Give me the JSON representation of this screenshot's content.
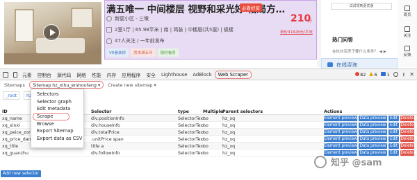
{
  "listing": {
    "title": "满五唯一 中间楼层 视野和采光好 格局方…",
    "badge": "必看好房",
    "community": "新壁小区 - 三墩",
    "layout": "2室1厅 | 65.98平米 | 南 | 简装 | 中楼层(共5层) | 板楼",
    "followers": "47人关注 / 一年前发布",
    "price": "210",
    "price_unit": "万",
    "unit_price": "单价31828元/平米",
    "tags": [
      "VR看装修",
      "房本满五年",
      "随时看房"
    ]
  },
  "right_panel": {
    "consult_label": "试试领到更优惠",
    "hot_questions_title": "热门问答",
    "hot_question_text": "在杭州买房子要什么条件？ ◀ ▶",
    "online_label": "在线咨询"
  },
  "sidebar_right": {
    "items": [
      "首页",
      "关注",
      "反馈"
    ]
  },
  "devtools": {
    "tabs": [
      "元素",
      "控制台",
      "源代码",
      "网络",
      "性能",
      "内存",
      "应用程序",
      "安全",
      "Lighthouse",
      "AdBlock",
      "Web Scraper"
    ],
    "active_tab": "Web Scraper",
    "error_count": "82",
    "warning_count": "6",
    "message_count": "1"
  },
  "ws_nav": {
    "sitemaps": "Sitemaps",
    "current_sitemap": "Sitemap hz_xihu_ershoufang ▾",
    "create_sitemap": "Create new sitemap ▾"
  },
  "breadcrumb": [
    "_root",
    "hz_xq"
  ],
  "dropdown": {
    "items": [
      "Selectors",
      "Selector graph",
      "Edit metadata",
      "Scrape",
      "Browse",
      "Export Sitemap",
      "Export data as CSV"
    ],
    "highlighted": "Scrape"
  },
  "table": {
    "headers": [
      "ID",
      "Selector",
      "type",
      "Multiple",
      "Parent selectors",
      "Actions"
    ],
    "rows": [
      {
        "id": "xq_name",
        "selector": "div.positionInfo",
        "type": "SelectorText",
        "multiple": "no",
        "parent": "hz_xq"
      },
      {
        "id": "xq_xinxi",
        "selector": "div.houseInfo",
        "type": "SelectorText",
        "multiple": "no",
        "parent": "hz_xq"
      },
      {
        "id": "xq_peice_zong",
        "selector": "div.totalPrice",
        "type": "SelectorText",
        "multiple": "no",
        "parent": "hz_xq"
      },
      {
        "id": "xq_price_dan",
        "selector": ".unitPrice span",
        "type": "SelectorText",
        "multiple": "no",
        "parent": "hz_xq"
      },
      {
        "id": "xq_title",
        "selector": "title a",
        "type": "SelectorText",
        "multiple": "no",
        "parent": "hz_xq"
      },
      {
        "id": "xq_guanzhu",
        "selector": "div.followInfo",
        "type": "SelectorText",
        "multiple": "no",
        "parent": "hz_xq"
      }
    ],
    "actions": {
      "preview": "Element preview",
      "data": "Data preview",
      "edit": "Edit",
      "delete": "Delete"
    }
  },
  "add_selector_label": "Add new selector",
  "watermark": "知乎 @sam",
  "colors": {
    "accent_blue": "#3a7ed1",
    "delete_red": "#e05247",
    "price_red": "#e4393c",
    "highlight_border": "#e57a7a"
  }
}
